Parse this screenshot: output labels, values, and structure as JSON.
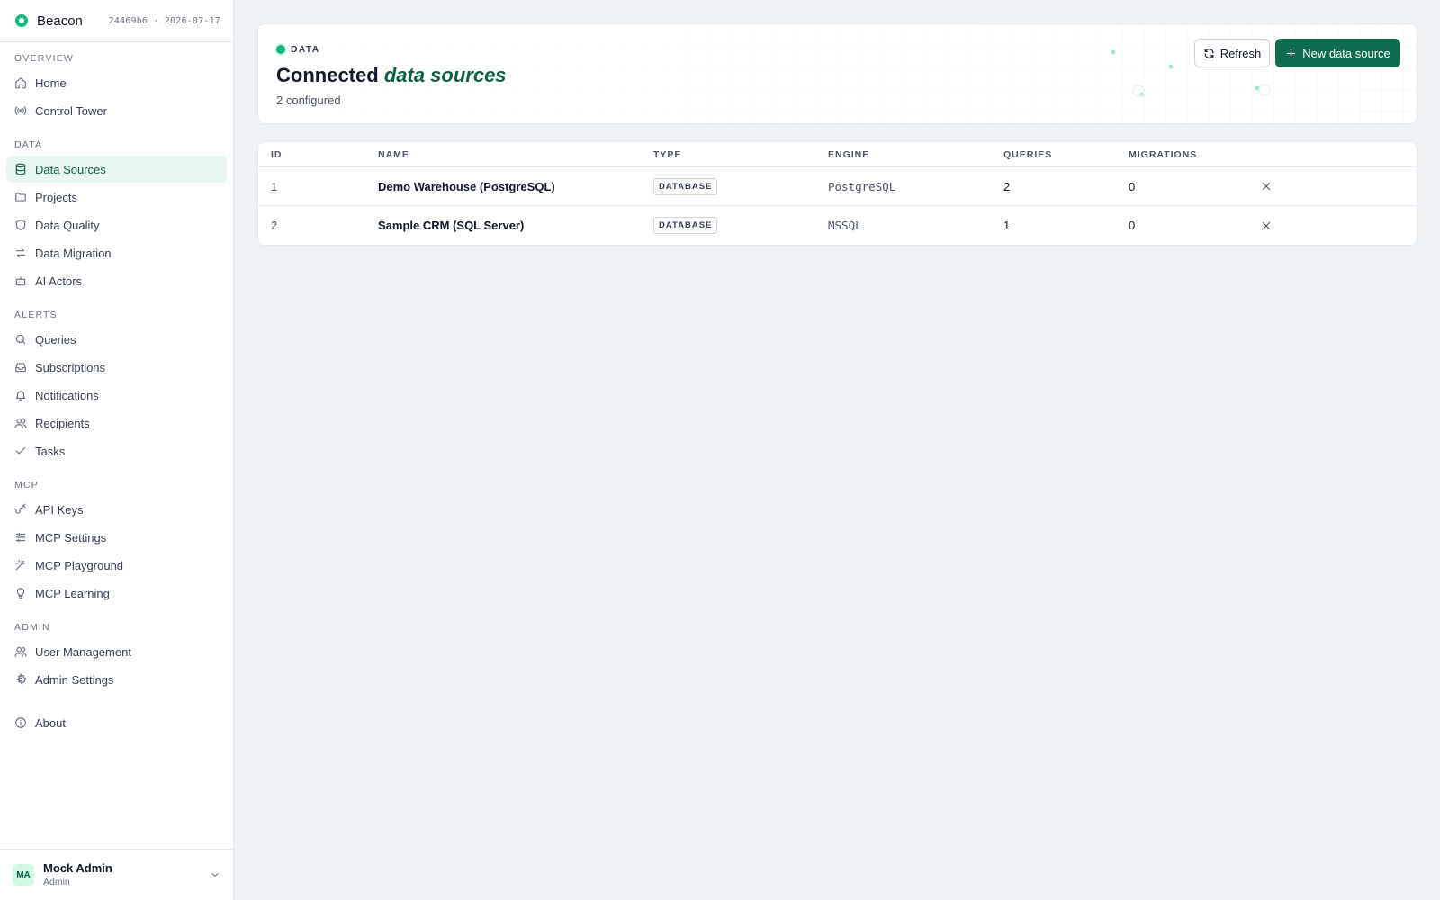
{
  "app": {
    "name": "Beacon",
    "build": "24469b6 · 2026-07-17"
  },
  "sidebar": {
    "sections": [
      {
        "label": "OVERVIEW",
        "items": [
          {
            "label": "Home",
            "icon": "home-icon"
          },
          {
            "label": "Control Tower",
            "icon": "broadcast-icon"
          }
        ]
      },
      {
        "label": "DATA",
        "items": [
          {
            "label": "Data Sources",
            "icon": "database-icon",
            "active": true
          },
          {
            "label": "Projects",
            "icon": "folder-icon"
          },
          {
            "label": "Data Quality",
            "icon": "shield-icon"
          },
          {
            "label": "Data Migration",
            "icon": "arrows-swap-icon"
          },
          {
            "label": "AI Actors",
            "icon": "robot-icon"
          }
        ]
      },
      {
        "label": "ALERTS",
        "items": [
          {
            "label": "Queries",
            "icon": "search-icon"
          },
          {
            "label": "Subscriptions",
            "icon": "inbox-icon"
          },
          {
            "label": "Notifications",
            "icon": "bell-icon"
          },
          {
            "label": "Recipients",
            "icon": "users-icon"
          },
          {
            "label": "Tasks",
            "icon": "check-icon"
          }
        ]
      },
      {
        "label": "MCP",
        "items": [
          {
            "label": "API Keys",
            "icon": "key-icon"
          },
          {
            "label": "MCP Settings",
            "icon": "sliders-icon"
          },
          {
            "label": "MCP Playground",
            "icon": "wand-icon"
          },
          {
            "label": "MCP Learning",
            "icon": "lightbulb-icon"
          }
        ]
      },
      {
        "label": "ADMIN",
        "items": [
          {
            "label": "User Management",
            "icon": "users-icon"
          },
          {
            "label": "Admin Settings",
            "icon": "gear-icon"
          }
        ]
      }
    ],
    "about": {
      "label": "About",
      "icon": "info-icon"
    },
    "user": {
      "initials": "MA",
      "name": "Mock Admin",
      "role": "Admin"
    }
  },
  "header": {
    "eyebrow": "DATA",
    "title_prefix": "Connected",
    "title_accent": "data sources",
    "count_text": "2 configured",
    "refresh_label": "Refresh",
    "new_label": "New data source"
  },
  "table": {
    "columns": [
      "ID",
      "NAME",
      "TYPE",
      "ENGINE",
      "QUERIES",
      "MIGRATIONS"
    ],
    "rows": [
      {
        "id": "1",
        "name": "Demo Warehouse (PostgreSQL)",
        "type": "DATABASE",
        "engine": "PostgreSQL",
        "queries": "2",
        "migrations": "0"
      },
      {
        "id": "2",
        "name": "Sample CRM (SQL Server)",
        "type": "DATABASE",
        "engine": "MSSQL",
        "queries": "1",
        "migrations": "0"
      }
    ]
  },
  "colors": {
    "accent": "#0f6b4f",
    "accent_light": "#e7f6ef",
    "brand_dot": "#10b981"
  }
}
